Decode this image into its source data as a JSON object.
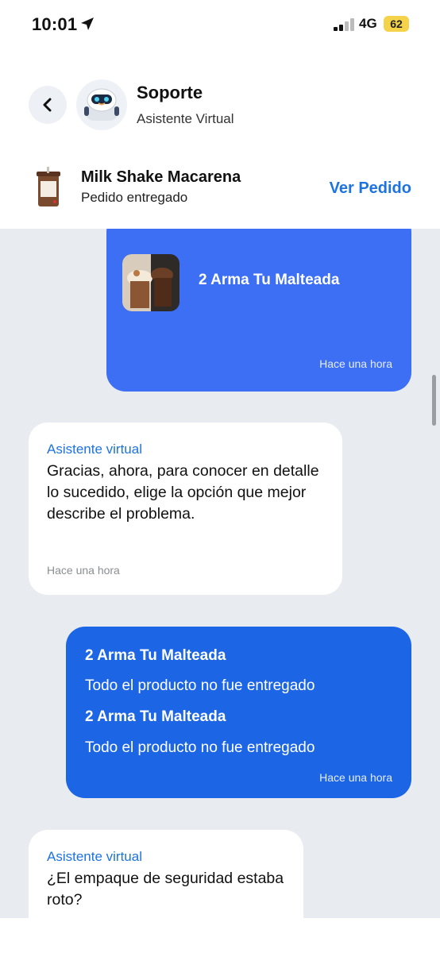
{
  "status_bar": {
    "time": "10:01",
    "network": "4G",
    "battery": "62"
  },
  "header": {
    "title": "Soporte",
    "subtitle": "Asistente Virtual",
    "avatar_icon": "robot-icon"
  },
  "order": {
    "brand_text": "MILK SHAKE",
    "name": "Milk Shake Macarena",
    "status": "Pedido entregado",
    "link_label": "Ver Pedido"
  },
  "messages": {
    "out1": {
      "product": "2 Arma Tu Malteada",
      "time": "Hace una hora"
    },
    "in1": {
      "sender": "Asistente virtual",
      "text": "Gracias, ahora, para conocer en detalle lo sucedido, elige la opción que mejor describe el problema.",
      "time": "Hace una hora"
    },
    "out2": {
      "items": [
        {
          "name": "2 Arma Tu Malteada",
          "reason": "Todo el producto no fue entregado"
        },
        {
          "name": "2 Arma Tu Malteada",
          "reason": "Todo el producto no fue entregado"
        }
      ],
      "time": "Hace una hora"
    },
    "in2": {
      "sender": "Asistente virtual",
      "text": "¿El empaque de seguridad estaba roto?"
    }
  },
  "colors": {
    "accent": "#1d73e0",
    "bubble_out_light": "#3d6ff5",
    "bubble_out_dark": "#1c66e6",
    "chat_bg": "#e8ebef"
  }
}
